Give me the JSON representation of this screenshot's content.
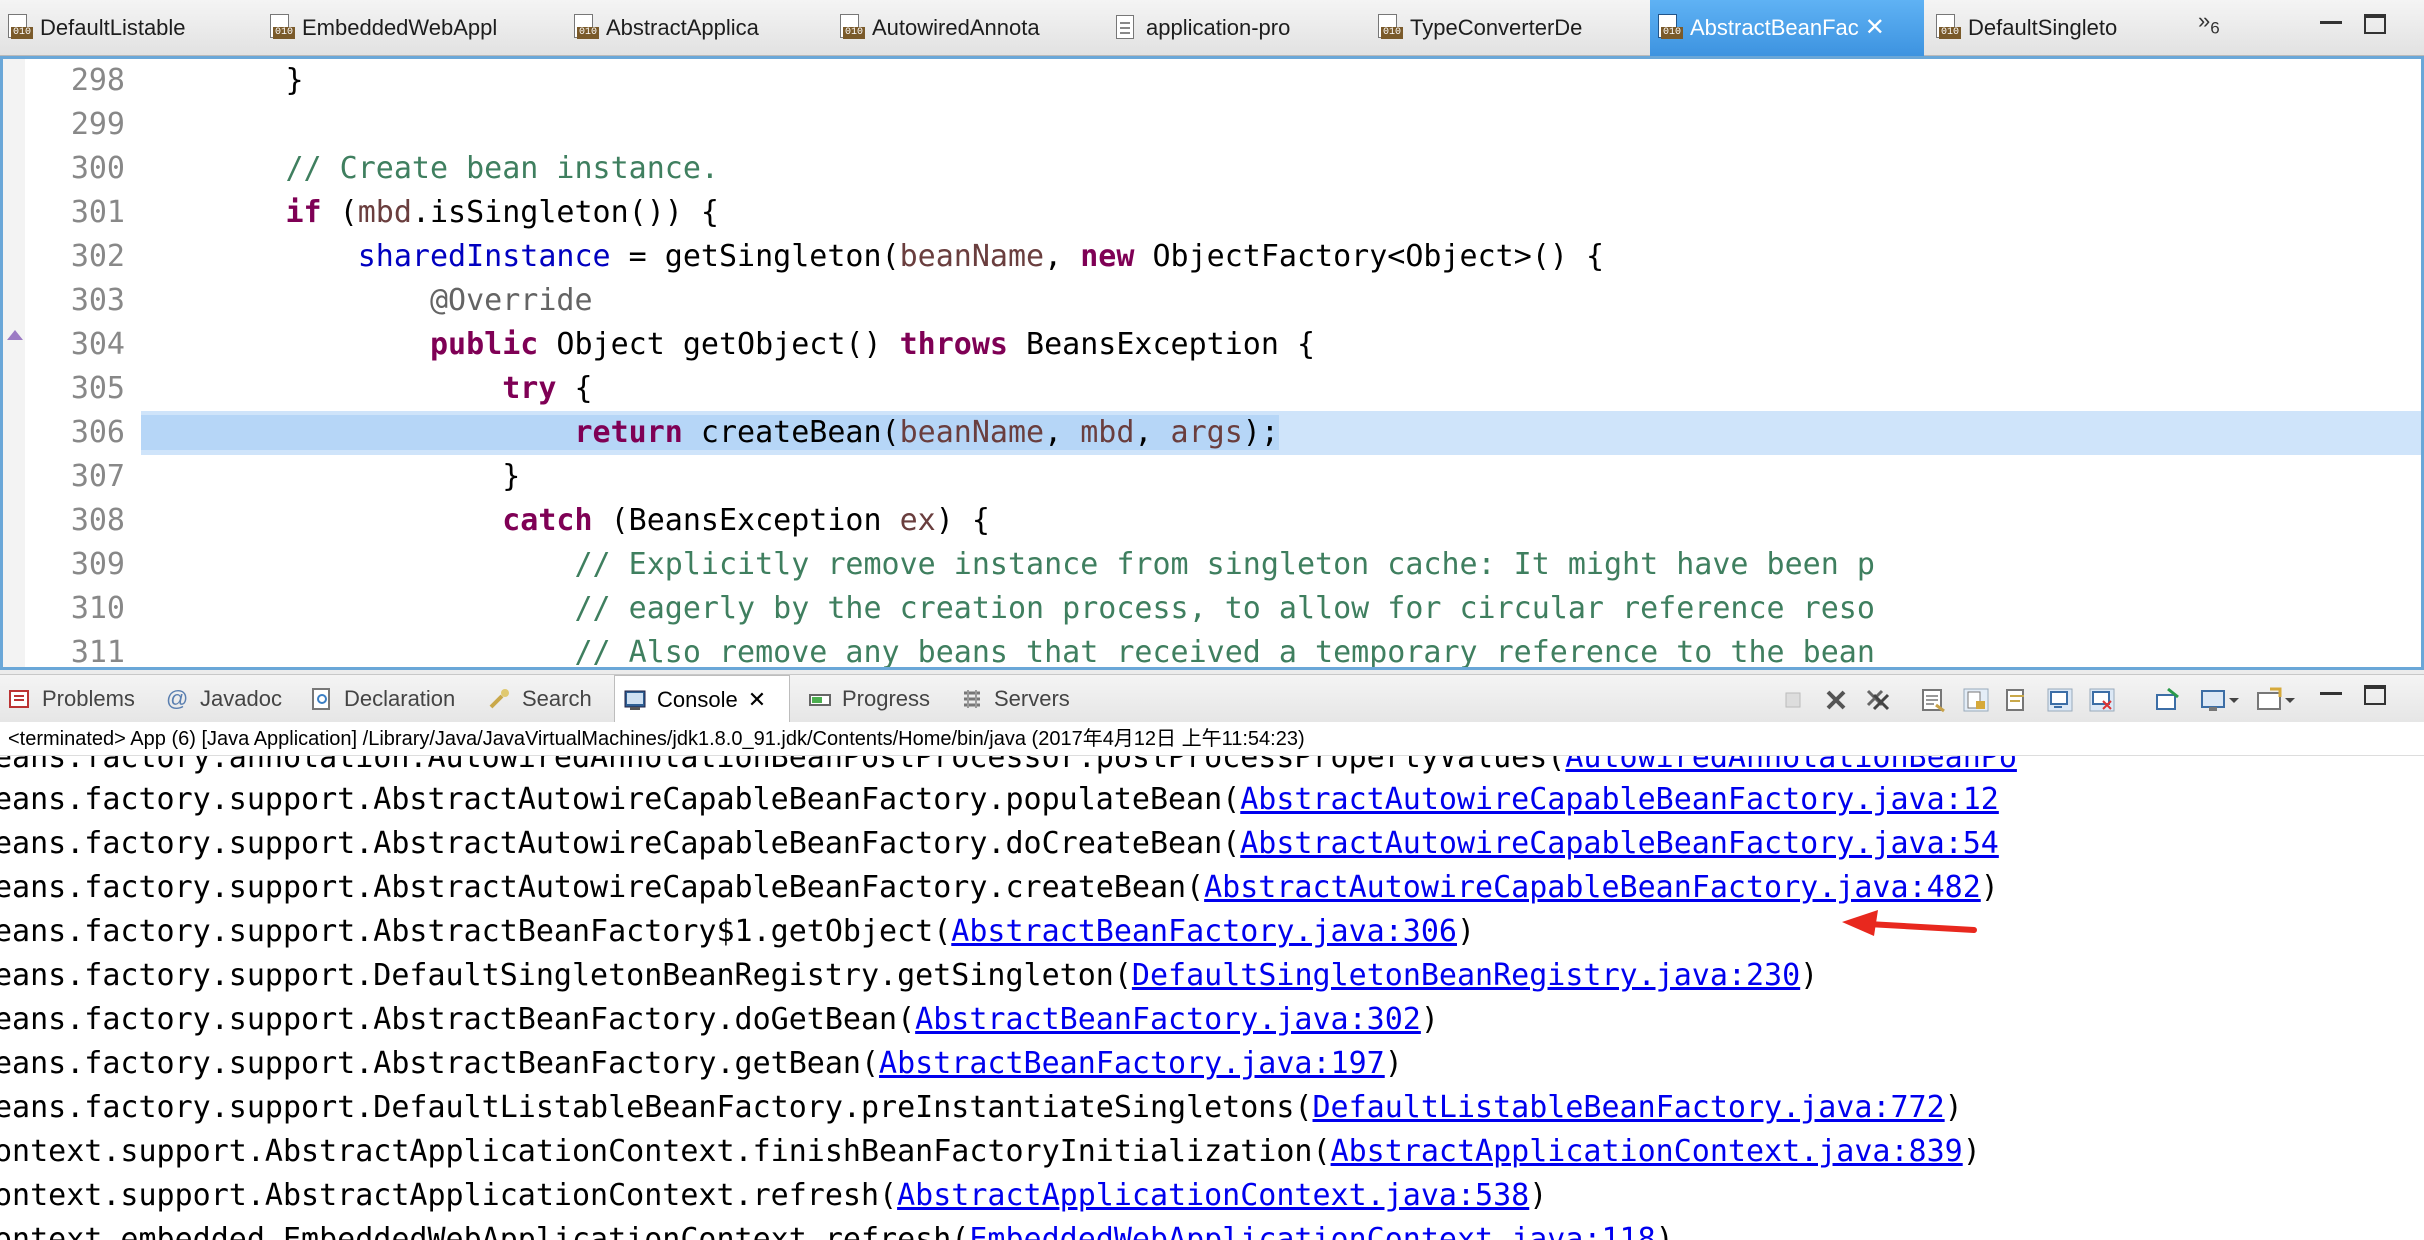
{
  "editor_tabs": [
    {
      "label": "DefaultListable",
      "icon": "class-file-icon",
      "active": false
    },
    {
      "label": "EmbeddedWebAppl",
      "icon": "class-file-icon",
      "active": false
    },
    {
      "label": "AbstractApplica",
      "icon": "class-file-icon",
      "active": false
    },
    {
      "label": "AutowiredAnnota",
      "icon": "class-file-icon",
      "active": false
    },
    {
      "label": "application-pro",
      "icon": "properties-file-icon",
      "active": false
    },
    {
      "label": "TypeConverterDe",
      "icon": "class-file-icon",
      "active": false
    },
    {
      "label": "AbstractBeanFac",
      "icon": "class-file-icon",
      "active": true
    },
    {
      "label": "DefaultSingleto",
      "icon": "class-file-icon",
      "active": false
    }
  ],
  "overflow_tabs": {
    "symbol": "»",
    "count": "6"
  },
  "editor": {
    "line_numbers": [
      "298",
      "299",
      "300",
      "301",
      "302",
      "303",
      "304",
      "305",
      "306",
      "307",
      "308",
      "309",
      "310",
      "311"
    ],
    "highlighted_line": "306",
    "lines": [
      "        }",
      "",
      "        // Create bean instance.",
      "        if (mbd.isSingleton()) {",
      "            sharedInstance = getSingleton(beanName, new ObjectFactory<Object>() {",
      "                @Override",
      "                public Object getObject() throws BeansException {",
      "                    try {",
      "                        return createBean(beanName, mbd, args);",
      "                    }",
      "                    catch (BeansException ex) {",
      "                        // Explicitly remove instance from singleton cache: It might have been p",
      "                        // eagerly by the creation process, to allow for circular reference reso",
      "                        // Also remove any beans that received a temporary reference to the bean"
    ]
  },
  "view_tabs": [
    {
      "label": "Problems",
      "icon": "problems-icon",
      "active": false
    },
    {
      "label": "Javadoc",
      "icon": "javadoc-icon",
      "active": false
    },
    {
      "label": "Declaration",
      "icon": "declaration-icon",
      "active": false
    },
    {
      "label": "Search",
      "icon": "search-icon",
      "active": false
    },
    {
      "label": "Console",
      "icon": "console-icon",
      "active": true
    },
    {
      "label": "Progress",
      "icon": "progress-icon",
      "active": false
    },
    {
      "label": "Servers",
      "icon": "servers-icon",
      "active": false
    }
  ],
  "console": {
    "status": "<terminated> App (6) [Java Application] /Library/Java/JavaVirtualMachines/jdk1.8.0_91.jdk/Contents/Home/bin/java (2017年4月12日 上午11:54:23)",
    "lines": [
      {
        "prefix": "eans.factory.annotation.AutowiredAnnotationBeanPostProcessor.postProcessPropertyValues(",
        "link": "AutowiredAnnotationBeanPo",
        "suffix": ""
      },
      {
        "prefix": "eans.factory.support.AbstractAutowireCapableBeanFactory.populateBean(",
        "link": "AbstractAutowireCapableBeanFactory.java:12",
        "suffix": ""
      },
      {
        "prefix": "eans.factory.support.AbstractAutowireCapableBeanFactory.doCreateBean(",
        "link": "AbstractAutowireCapableBeanFactory.java:54",
        "suffix": ""
      },
      {
        "prefix": "eans.factory.support.AbstractAutowireCapableBeanFactory.createBean(",
        "link": "AbstractAutowireCapableBeanFactory.java:482",
        "suffix": ")"
      },
      {
        "prefix": "eans.factory.support.AbstractBeanFactory$1.getObject(",
        "link": "AbstractBeanFactory.java:306",
        "suffix": ")"
      },
      {
        "prefix": "eans.factory.support.DefaultSingletonBeanRegistry.getSingleton(",
        "link": "DefaultSingletonBeanRegistry.java:230",
        "suffix": ")"
      },
      {
        "prefix": "eans.factory.support.AbstractBeanFactory.doGetBean(",
        "link": "AbstractBeanFactory.java:302",
        "suffix": ")"
      },
      {
        "prefix": "eans.factory.support.AbstractBeanFactory.getBean(",
        "link": "AbstractBeanFactory.java:197",
        "suffix": ")"
      },
      {
        "prefix": "eans.factory.support.DefaultListableBeanFactory.preInstantiateSingletons(",
        "link": "DefaultListableBeanFactory.java:772",
        "suffix": ")"
      },
      {
        "prefix": "ontext.support.AbstractApplicationContext.finishBeanFactoryInitialization(",
        "link": "AbstractApplicationContext.java:839",
        "suffix": ")"
      },
      {
        "prefix": "ontext.support.AbstractApplicationContext.refresh(",
        "link": "AbstractApplicationContext.java:538",
        "suffix": ")"
      },
      {
        "prefix": "ontext.embedded.EmbeddedWebApplicationContext.refresh(",
        "link": "EmbeddedWebApplicationContext.java:118",
        "suffix": ")"
      }
    ]
  },
  "colors": {
    "link": "#0000ee",
    "annotation_arrow": "#e8281e",
    "active_tab": "#3d93e0",
    "line_highlight": "#cfe4fa"
  }
}
